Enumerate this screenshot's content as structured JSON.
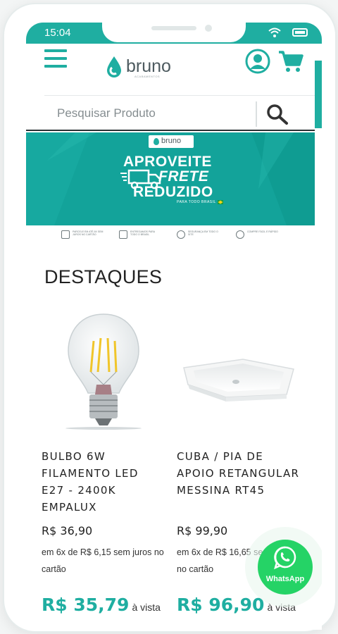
{
  "status_bar": {
    "time": "15:04"
  },
  "header": {
    "logo_text": "bruno",
    "logo_subtitle": "ACABAMENTOS"
  },
  "search": {
    "placeholder": "Pesquisar Produto"
  },
  "banner": {
    "logo_text": "bruno",
    "line1": "APROVEITE",
    "line2": "FRETE",
    "line3": "REDUZIDO",
    "line4": "PARA TODO BRASIL"
  },
  "features": [
    "PARCELE EM ATÉ 6X SEM JUROS NO CARTÃO",
    "ENTREGAMOS PARA TODO O BRASIL",
    "SEGURANÇA EM TODO O SITE",
    "COMPRE FÁCIL E RÁPIDO"
  ],
  "section": {
    "title": "DESTAQUES"
  },
  "products": [
    {
      "name": "BULBO 6W FILAMENTO LED E27 - 2400K EMPALUX",
      "price": "R$ 36,90",
      "inst_prefix": "em ",
      "inst_count": "6x",
      "inst_mid": " de ",
      "inst_value": "R$ 6,15",
      "inst_suffix": " sem juros no cartão",
      "cash_price": "R$ 35,79",
      "cash_label": "à vista",
      "image": "led-filament-bulb"
    },
    {
      "name": "CUBA / PIA DE APOIO RETANGULAR MESSINA RT45",
      "price": "R$ 99,90",
      "inst_prefix": "em ",
      "inst_count": "6x",
      "inst_mid": " de ",
      "inst_value": "R$ 16,65",
      "inst_suffix": " sem juros no cartão",
      "cash_price": "R$ 96,90",
      "cash_label": "à vista",
      "image": "rectangular-sink"
    }
  ],
  "whatsapp": {
    "label": "WhatsApp"
  },
  "colors": {
    "brand_teal": "#1faea1",
    "banner_teal": "#13a39a",
    "whatsapp_green": "#25d366"
  },
  "icons": [
    "menu-icon",
    "user-icon",
    "cart-icon",
    "search-icon",
    "wifi-icon",
    "battery-icon",
    "whatsapp-icon",
    "truck-icon"
  ]
}
